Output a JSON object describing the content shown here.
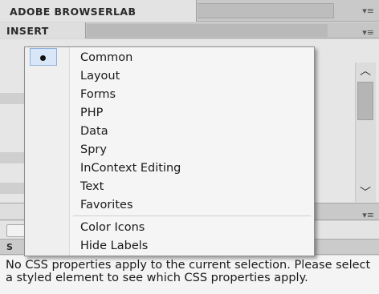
{
  "panels": {
    "browserlab_tab": "ADOBE BROWSERLAB",
    "insert_tab": "INSERT",
    "css_panel_message": "No CSS properties apply to the current selection.  Please select a styled element to see which CSS properties apply."
  },
  "insert_menu": {
    "items": [
      {
        "label": "Common",
        "selected": true
      },
      {
        "label": "Layout"
      },
      {
        "label": "Forms"
      },
      {
        "label": "PHP"
      },
      {
        "label": "Data"
      },
      {
        "label": "Spry"
      },
      {
        "label": "InContext Editing"
      },
      {
        "label": "Text"
      },
      {
        "label": "Favorites"
      }
    ],
    "options": [
      {
        "label": "Color Icons"
      },
      {
        "label": "Hide Labels"
      }
    ]
  },
  "colors": {
    "panel_bg": "#e6e6e6",
    "menu_bg": "#f5f5f5",
    "selection_bg": "#d9e6f7"
  }
}
